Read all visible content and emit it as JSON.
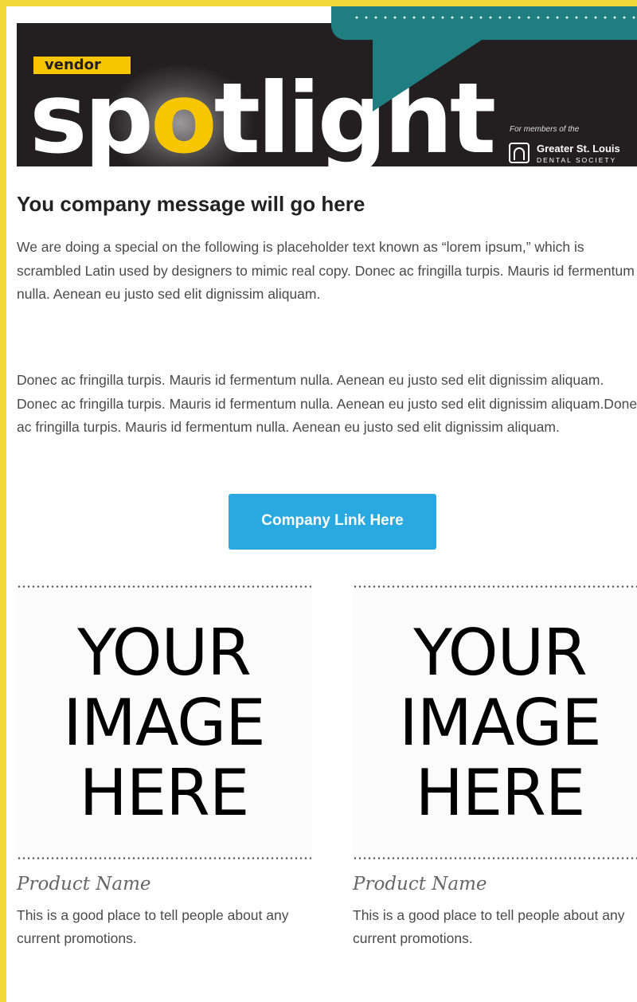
{
  "banner": {
    "tag": "vendor",
    "wordmark_start": "sp",
    "wordmark_o": "o",
    "wordmark_end": "tlight",
    "members_label": "For members of the",
    "org_name": "Greater St. Louis",
    "org_sub": "DENTAL SOCIETY",
    "org_icon": "arch-logo-icon"
  },
  "content": {
    "headline": "You company message will go here",
    "paragraph_1": "We are doing a special on the following is placeholder text known as “lorem ipsum,” which is scrambled Latin used by designers to mimic real copy. Donec ac fringilla turpis. Mauris id fermentum nulla. Aenean eu justo sed elit dignissim aliquam.",
    "paragraph_2": "Donec ac fringilla turpis. Mauris id fermentum nulla. Aenean eu justo sed elit dignissim aliquam. Donec ac fringilla turpis. Mauris id fermentum nulla. Aenean eu justo sed elit dignissim aliquam.Donec ac fringilla turpis. Mauris id fermentum nulla. Aenean eu justo sed elit dignissim aliquam.",
    "cta_label": "Company Link Here"
  },
  "products": [
    {
      "image_line_1": "YOUR",
      "image_line_2": "IMAGE",
      "image_line_3": "HERE",
      "name": "Product Name",
      "description": "This is a good place to tell people about any current promotions."
    },
    {
      "image_line_1": "YOUR",
      "image_line_2": "IMAGE",
      "image_line_3": "HERE",
      "name": "Product Name",
      "description": "This is a good place to tell people about any current promotions."
    }
  ],
  "colors": {
    "frame": "#f4d83a",
    "banner_bg": "#231f20",
    "accent_yellow": "#f7c600",
    "teal": "#1f7f80",
    "button": "#2aa9e0"
  }
}
